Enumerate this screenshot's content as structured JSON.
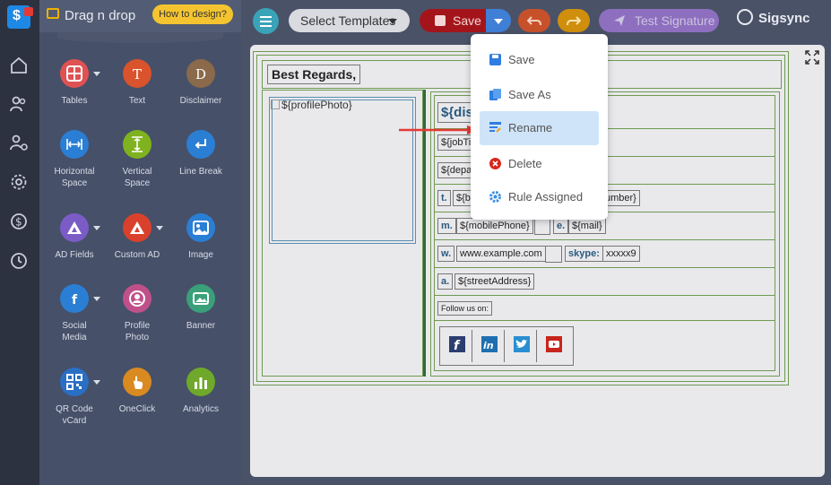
{
  "app": {
    "user_name": "Sigsync"
  },
  "sidebar": {
    "title": "Drag n drop",
    "howto_label": "How to design?",
    "tools": [
      {
        "label": "Tables",
        "icon": "table-icon",
        "color": "#e05252"
      },
      {
        "label": "Text",
        "icon": "text-icon",
        "color": "#d9532c"
      },
      {
        "label": "Disclaimer",
        "icon": "disclaimer-icon",
        "color": "#8a6a4a"
      },
      {
        "label": "Horizontal Space",
        "icon": "horizontal-space-icon",
        "color": "#2a7fd4"
      },
      {
        "label": "Vertical Space",
        "icon": "vertical-space-icon",
        "color": "#7fb21e"
      },
      {
        "label": "Line Break",
        "icon": "line-break-icon",
        "color": "#2a7fd4"
      },
      {
        "label": "AD Fields",
        "icon": "ad-fields-icon",
        "color": "#7b5cc7"
      },
      {
        "label": "Custom AD",
        "icon": "custom-ad-icon",
        "color": "#d9412c"
      },
      {
        "label": "Image",
        "icon": "image-icon",
        "color": "#2a7fd4"
      },
      {
        "label": "Social Media",
        "icon": "social-media-icon",
        "color": "#2a7fd4"
      },
      {
        "label": "Profile Photo",
        "icon": "profile-photo-icon",
        "color": "#c0508a"
      },
      {
        "label": "Banner",
        "icon": "banner-icon",
        "color": "#3aa07a"
      },
      {
        "label": "QR Code vCard",
        "icon": "qr-code-icon",
        "color": "#2a6fc4"
      },
      {
        "label": "OneClick",
        "icon": "oneclick-icon",
        "color": "#d98a20"
      },
      {
        "label": "Analytics",
        "icon": "analytics-icon",
        "color": "#6fa82a"
      }
    ]
  },
  "toolbar": {
    "templates_label": "Select Templates",
    "save_label": "Save",
    "test_label": "Test Signature"
  },
  "dropdown": {
    "items": [
      {
        "label": "Save",
        "icon": "floppy-icon"
      },
      {
        "label": "Save As",
        "icon": "copy-icon"
      },
      {
        "label": "Rename",
        "icon": "rename-icon"
      },
      {
        "label": "Delete",
        "icon": "delete-icon"
      },
      {
        "label": "Rule Assigned",
        "icon": "gear-icon"
      }
    ],
    "active": "Rename"
  },
  "signature": {
    "greeting": "Best Regards,",
    "photo_placeholder": "${profilePhoto}",
    "display_name": "${dis",
    "job_title": "${jobTi",
    "department": "${depa",
    "phone_label": "t.",
    "phone_value": "${b",
    "phone_tail": "umber}",
    "mobile_label": "m.",
    "mobile_value": "${mobilePhone}",
    "email_label": "e.",
    "email_value": "${mail}",
    "web_label": "w.",
    "web_value": "www.example.com",
    "skype_label": "skype:",
    "skype_value": "xxxxx9",
    "address_label": "a.",
    "address_value": "${streetAddress}",
    "follow_label": "Follow us on:"
  }
}
